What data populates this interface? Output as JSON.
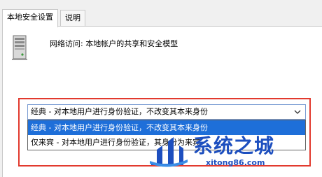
{
  "tabs": [
    {
      "label": "本地安全设置"
    },
    {
      "label": "说明"
    }
  ],
  "policy": {
    "icon": "server-icon",
    "label": "网络访问: 本地帐户的共享和安全模型"
  },
  "sharing_model": {
    "selected": "经典 - 对本地用户进行身份验证，不改变其本来身份",
    "options": [
      "经典 - 对本地用户进行身份验证，不改变其本来身份",
      "仅来宾 - 对本地用户进行身份验证，其身份为来宾"
    ]
  },
  "watermark": {
    "title": "系统之城",
    "url": "xitong86.com",
    "icon": "xitong-logo-icon"
  },
  "colors": {
    "highlight": "#e23a2e",
    "selection": "#1e6fd9",
    "watermark": "#1d4fbf"
  }
}
